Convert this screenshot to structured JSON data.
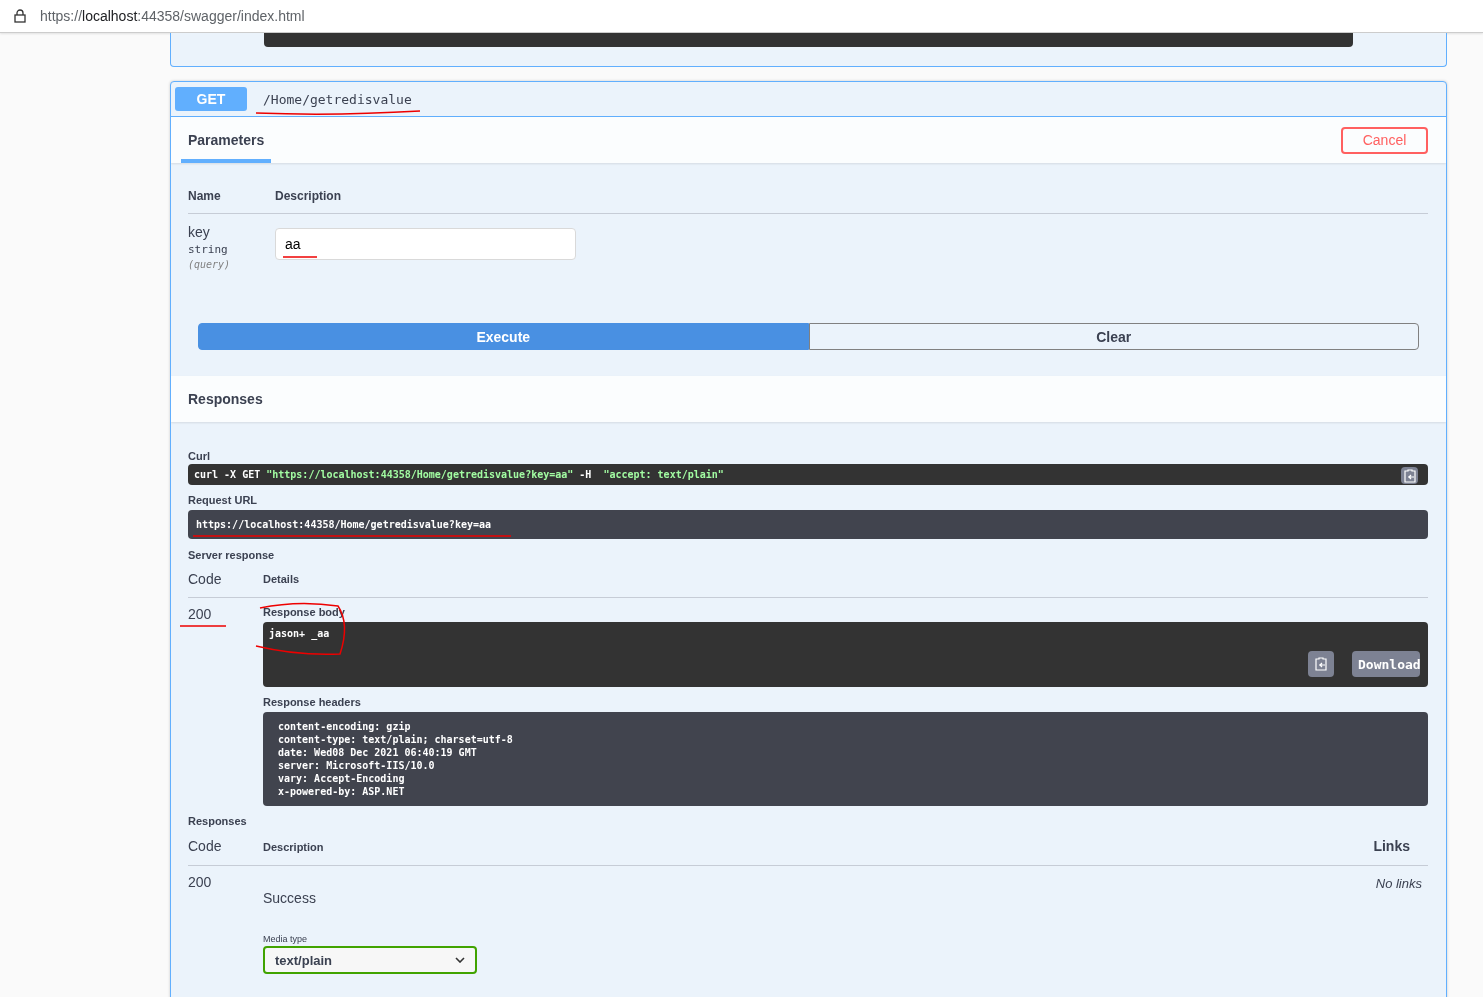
{
  "address_bar": {
    "url_prefix": "https://",
    "url_host": "localhost",
    "url_rest": ":44358/swagger/index.html"
  },
  "operation": {
    "method": "GET",
    "path": "/Home/getredisvalue",
    "expanded": true
  },
  "parameters_tab": {
    "label": "Parameters",
    "selected": true
  },
  "cancel_button": "Cancel",
  "parameters_table": {
    "columns": [
      "Name",
      "Description"
    ],
    "rows": [
      {
        "name": "key",
        "type": "string",
        "location": "(query)",
        "value": "aa"
      }
    ]
  },
  "execute_button": "Execute",
  "clear_button": "Clear",
  "responses_title": "Responses",
  "curl": {
    "label": "Curl",
    "parts": [
      {
        "kind": "plain",
        "text": "curl -X GET "
      },
      {
        "kind": "string",
        "text": "\"https://localhost:44358/Home/getredisvalue?key=aa\""
      },
      {
        "kind": "plain",
        "text": " -H  "
      },
      {
        "kind": "string",
        "text": "\"accept: text/plain\""
      }
    ]
  },
  "request_url": {
    "label": "Request URL",
    "value": "https://localhost:44358/Home/getredisvalue?key=aa"
  },
  "server_response": {
    "label": "Server response",
    "columns": [
      "Code",
      "Details"
    ],
    "code": "200",
    "body_label": "Response body",
    "body": "jason+ _aa",
    "download_button": "Download",
    "headers_label": "Response headers",
    "headers": [
      "content-encoding: gzip",
      "content-type: text/plain; charset=utf-8",
      "date: Wed08 Dec 2021 06:40:19 GMT",
      "server: Microsoft-IIS/10.0",
      "vary: Accept-Encoding",
      "x-powered-by: ASP.NET"
    ]
  },
  "responses": {
    "label": "Responses",
    "columns": [
      "Code",
      "Description",
      "Links"
    ],
    "rows": [
      {
        "code": "200",
        "description": "Success",
        "links": "No links",
        "media_type_label": "Media type",
        "media_type": "text/plain"
      }
    ]
  }
}
